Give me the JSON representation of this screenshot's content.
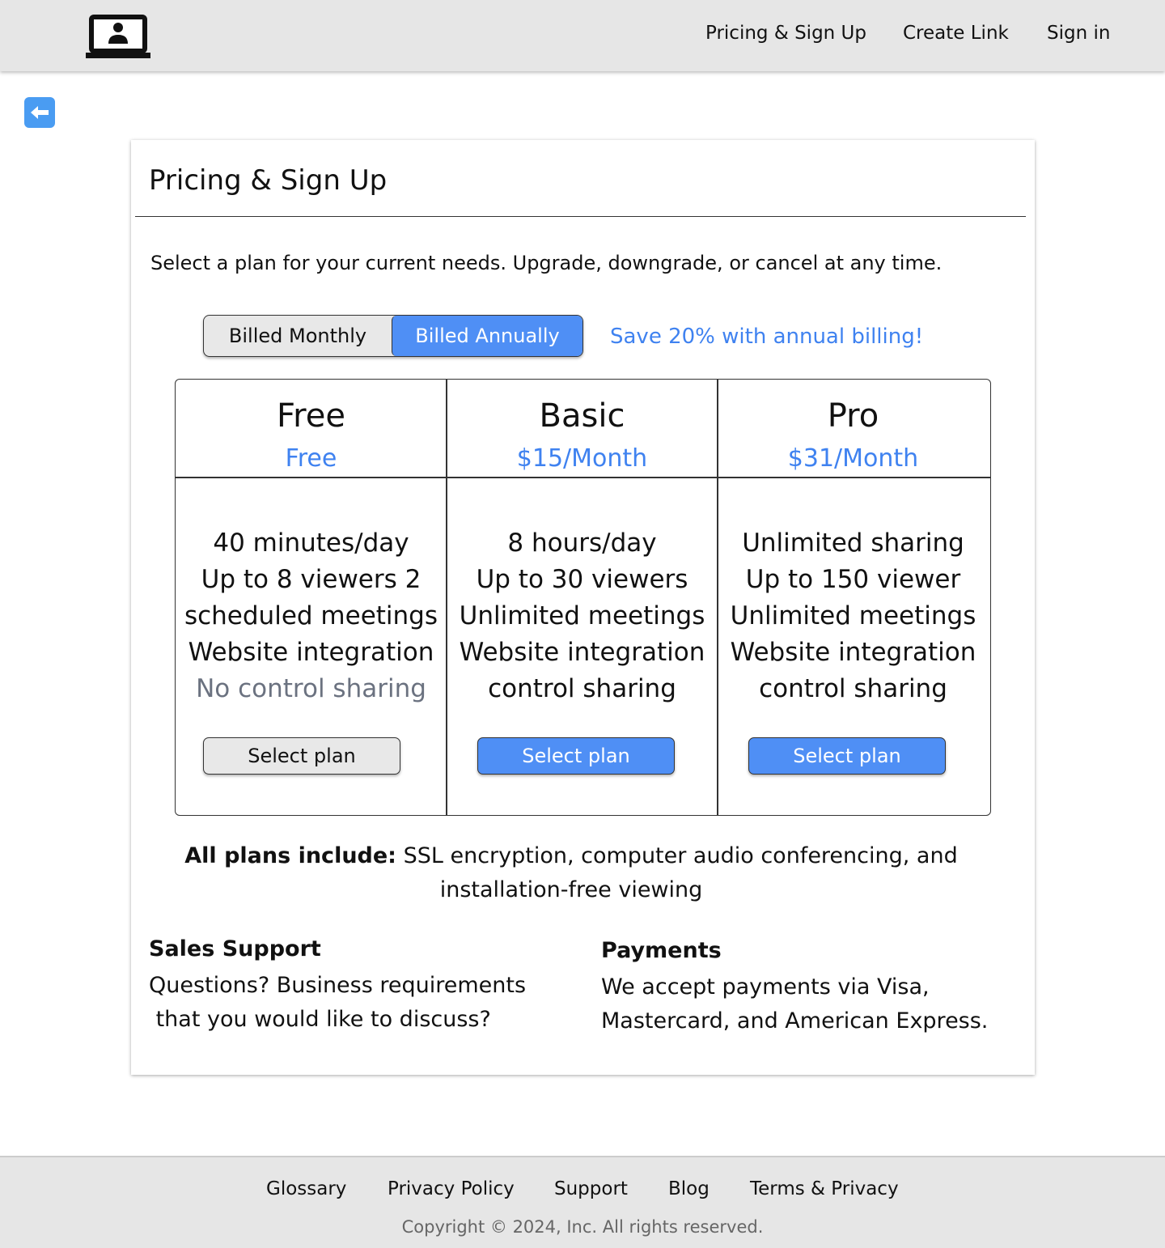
{
  "header": {
    "nav": [
      "Pricing & Sign Up",
      "Create Link",
      "Sign in"
    ]
  },
  "page": {
    "title": "Pricing & Sign Up",
    "intro": "Select a plan for your current needs. Upgrade, downgrade, or cancel at any time.",
    "billing": {
      "monthly": "Billed Monthly",
      "annual": "Billed Annually",
      "selected": "Billed Annually",
      "save_note": "Save 20% with annual billing!"
    },
    "plans": [
      {
        "name": "Free",
        "price": "Free",
        "features": [
          "40 minutes/day",
          "Up to 8 viewers 2",
          "scheduled meetings",
          "Website integration",
          "No control sharing"
        ],
        "button": "Select plan"
      },
      {
        "name": "Basic",
        "price": "$15/Month",
        "features": [
          "8 hours/day",
          "Up to 30 viewers",
          "Unlimited meetings",
          "Website integration",
          "control sharing"
        ],
        "button": "Select plan"
      },
      {
        "name": "Pro",
        "price": "$31/Month",
        "features": [
          "Unlimited sharing",
          "Up to 150 viewer",
          "Unlimited meetings",
          "Website integration",
          "control sharing"
        ],
        "button": "Select plan"
      }
    ],
    "all_plans_label": "All plans include:",
    "all_plans_text_1": " SSL encryption, computer audio conferencing, and",
    "all_plans_text_2": "installation-free viewing",
    "sales": {
      "title": "Sales Support",
      "line1": "Questions? Business requirements",
      "line2": " that you would like to discuss?"
    },
    "payments": {
      "title": "Payments",
      "line1": "We accept payments via Visa,",
      "line2": "Mastercard, and American Express."
    }
  },
  "footer": {
    "links": [
      "Glossary",
      "Privacy Policy",
      "Support",
      "Blog",
      "Terms & Privacy"
    ],
    "copyright": "Copyright © 2024, Inc. All rights reserved."
  },
  "colors": {
    "accent": "#4f8ff5",
    "link_text": "#3f82f0",
    "header_bg": "#e6e6e6"
  }
}
